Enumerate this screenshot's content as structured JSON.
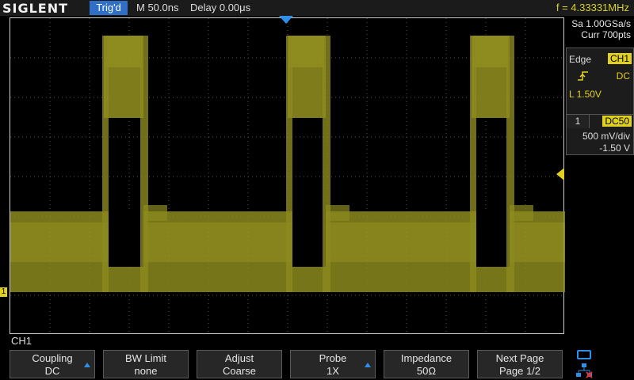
{
  "top": {
    "brand": "SIGLENT",
    "trig_status": "Trig'd",
    "timebase": "M 50.0ns",
    "delay": "Delay 0.00μs",
    "frequency": "f = 4.33331MHz"
  },
  "acquisition": {
    "sample_rate": "Sa 1.00GSa/s",
    "curr_pts": "Curr 700pts"
  },
  "trigger": {
    "type": "Edge",
    "source": "CH1",
    "coupling": "DC",
    "level": "L  1.50V"
  },
  "channel": {
    "number": "1",
    "impedance": "DC50",
    "scale": "500 mV/div",
    "offset": "-1.50 V",
    "label": "CH1"
  },
  "softkeys": [
    {
      "line1": "Coupling",
      "line2": "DC",
      "arrow": true
    },
    {
      "line1": "BW Limit",
      "line2": "none",
      "arrow": false
    },
    {
      "line1": "Adjust",
      "line2": "Coarse",
      "arrow": false
    },
    {
      "line1": "Probe",
      "line2": "1X",
      "arrow": true
    },
    {
      "line1": "Impedance",
      "line2": "50Ω",
      "arrow": false
    },
    {
      "line1": "Next Page",
      "line2": "Page 1/2",
      "arrow": false
    }
  ],
  "colors": {
    "trace": "#8c8a1e",
    "trace_bright": "#b7b22a",
    "accent_blue": "#2f8ee8",
    "ch1_yellow": "#e0d020"
  }
}
